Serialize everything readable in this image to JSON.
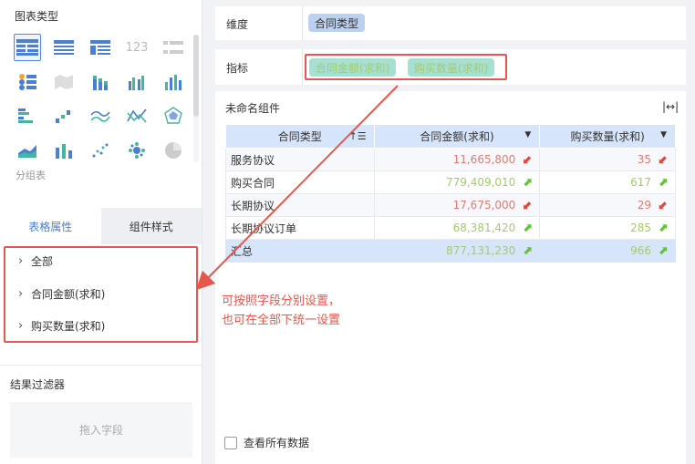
{
  "left_panel": {
    "chart_types_title": "图表类型",
    "chart_icon_123": "123",
    "selected_type_label": "分组表",
    "tabs": [
      {
        "label": "表格属性",
        "active": true
      },
      {
        "label": "组件样式",
        "active": false
      }
    ],
    "properties": [
      "全部",
      "合同金额(求和)",
      "购买数量(求和)"
    ],
    "filter_title": "结果过滤器",
    "drop_placeholder": "拖入字段"
  },
  "dimension_bar": {
    "label": "维度",
    "fields": [
      "合同类型"
    ]
  },
  "metric_bar": {
    "label": "指标",
    "fields": [
      "合同金额(求和)",
      "购买数量(求和)"
    ]
  },
  "widget": {
    "title": "未命名组件",
    "columns": [
      "合同类型",
      "合同金额(求和)",
      "购买数量(求和)"
    ],
    "rows": [
      {
        "name": "服务协议",
        "amount": "11,665,800",
        "amount_trend": "down",
        "qty": "35",
        "qty_trend": "down"
      },
      {
        "name": "购买合同",
        "amount": "779,409,010",
        "amount_trend": "up",
        "qty": "617",
        "qty_trend": "up"
      },
      {
        "name": "长期协议",
        "amount": "17,675,000",
        "amount_trend": "down",
        "qty": "29",
        "qty_trend": "down"
      },
      {
        "name": "长期协议订单",
        "amount": "68,381,420",
        "amount_trend": "up",
        "qty": "285",
        "qty_trend": "up"
      }
    ],
    "total": {
      "name": "汇总",
      "amount": "877,131,230",
      "amount_trend": "up",
      "qty": "966",
      "qty_trend": "up"
    },
    "show_all_label": "查看所有数据"
  },
  "annotation": {
    "line1": "可按照字段分别设置，",
    "line2": "也可在全部下统一设置"
  },
  "colors": {
    "accent": "#4a7fd6",
    "highlight": "#e8574b",
    "trend_down": "#e5453b",
    "trend_up": "#67c23a"
  }
}
